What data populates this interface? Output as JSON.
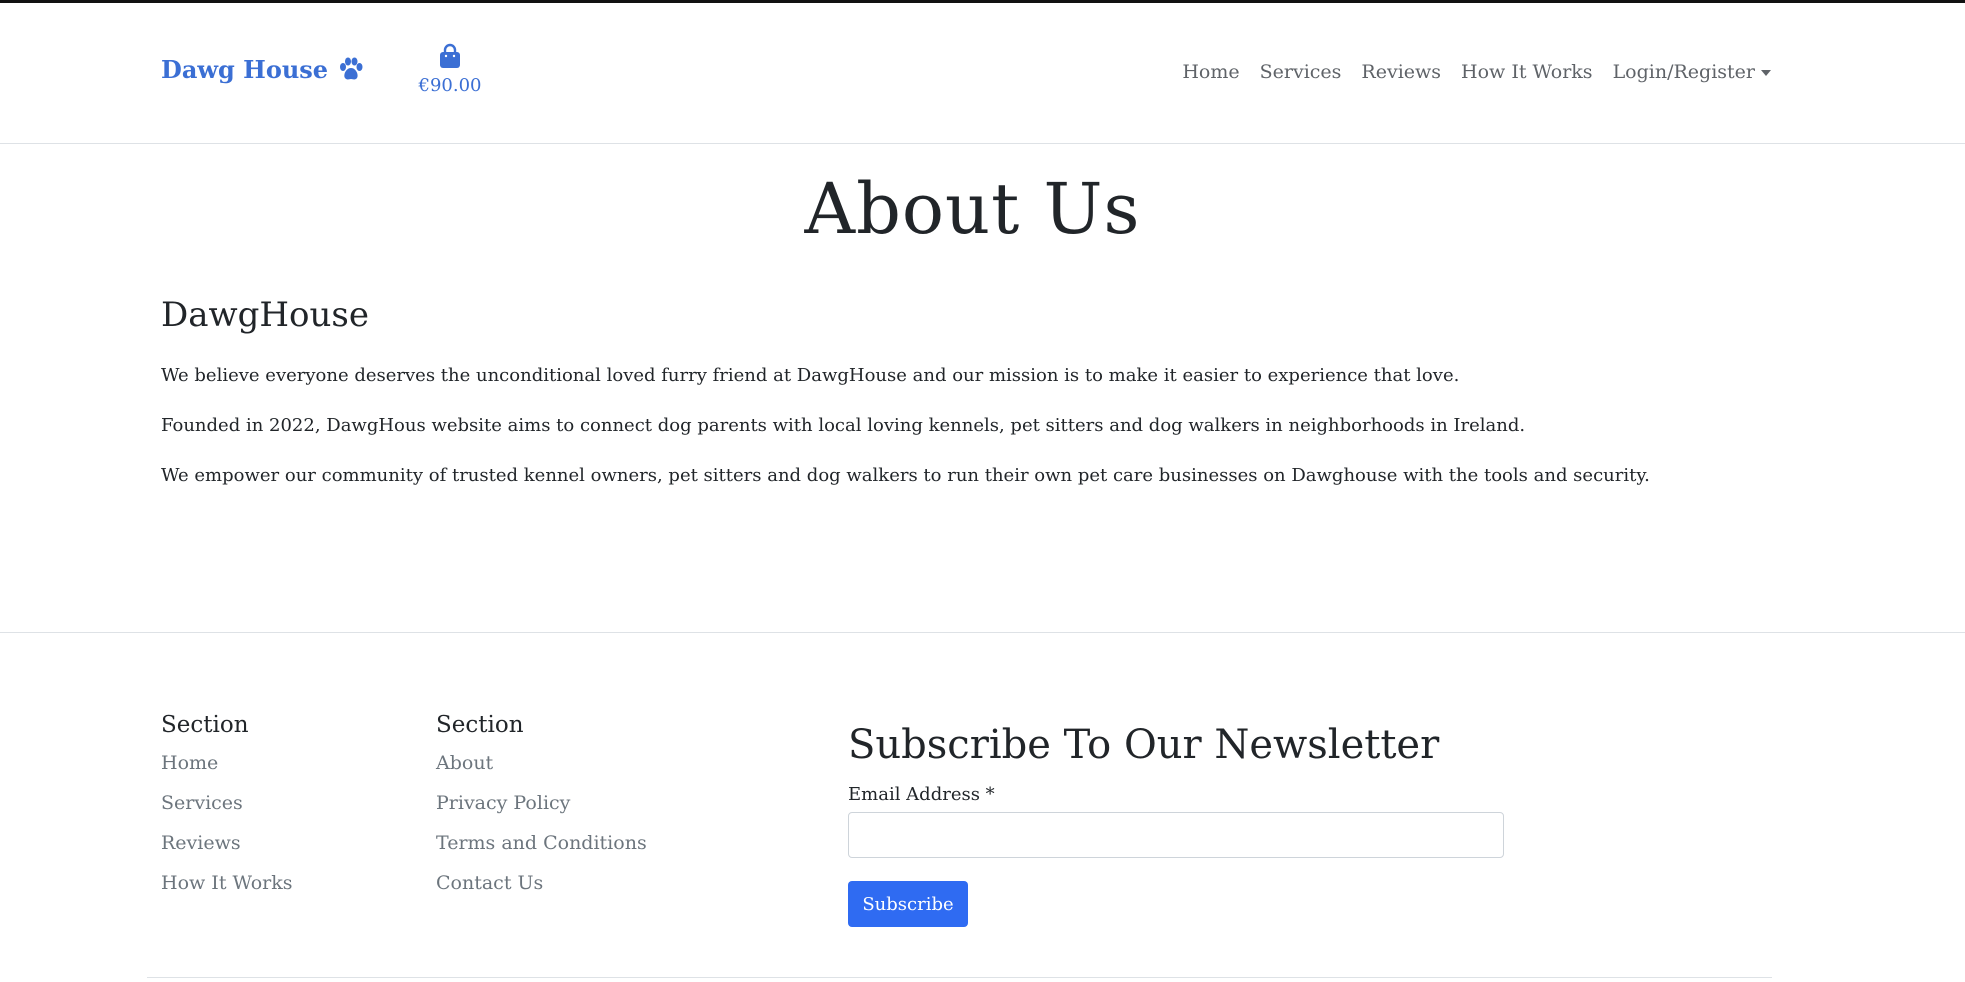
{
  "header": {
    "brand": "Dawg House",
    "brand_icon": "paw-icon",
    "cart_icon": "shopping-bag-icon",
    "cart_total": "€90.00",
    "nav": {
      "home": "Home",
      "services": "Services",
      "reviews": "Reviews",
      "how_it_works": "How It Works",
      "login_register": "Login/Register"
    }
  },
  "main": {
    "title": "About Us",
    "subtitle": "DawgHouse",
    "paragraphs": [
      "We believe everyone deserves the unconditional loved furry friend at DawgHouse and our mission is to make it easier to experience that love.",
      "Founded in 2022, DawgHous website aims to connect dog parents with local loving kennels, pet sitters and dog walkers in neighborhoods in Ireland.",
      "We empower our community of trusted kennel owners, pet sitters and dog walkers to run their own pet care businesses on Dawghouse with the tools and security."
    ]
  },
  "footer": {
    "columns": [
      {
        "title": "Section",
        "links": [
          "Home",
          "Services",
          "Reviews",
          "How It Works"
        ]
      },
      {
        "title": "Section",
        "links": [
          "About",
          "Privacy Policy",
          "Terms and Conditions",
          "Contact Us"
        ]
      }
    ],
    "newsletter": {
      "title": "Subscribe To Our Newsletter",
      "email_label": "Email Address *",
      "email_value": "",
      "email_placeholder": "",
      "button_label": "Subscribe"
    }
  },
  "colors": {
    "brand": "#3b6fd4",
    "button": "#2f6bf2",
    "nav_text": "#5f6368",
    "footer_link": "#6c757d"
  }
}
